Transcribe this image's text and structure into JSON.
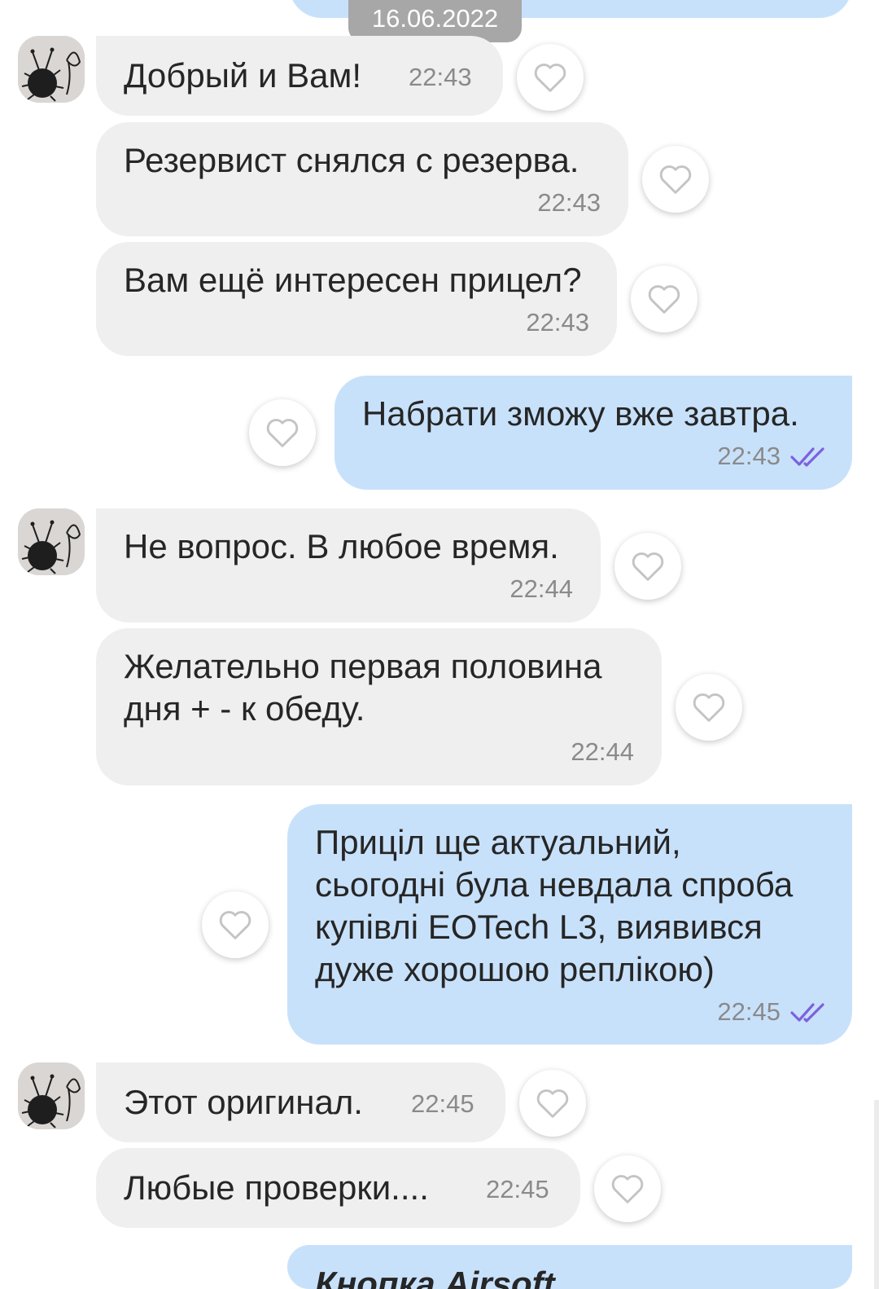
{
  "date_separator": "16.06.2022",
  "colors": {
    "incoming": "#efefef",
    "outgoing": "#c8e1fb",
    "read_ticks": "#7b61e0"
  },
  "icons": {
    "like": "heart-outline-icon",
    "read": "double-check-icon",
    "avatar": "fuzzy-bug-avatar"
  },
  "messages": [
    {
      "text": "Добрый и Вам!",
      "time": "22:43"
    },
    {
      "text": "Резервист снялся с резерва.",
      "time": "22:43"
    },
    {
      "text": "Вам ещё интересен прицел?",
      "time": "22:43"
    },
    {
      "text": "Набрати зможу вже завтра.",
      "time": "22:43"
    },
    {
      "text": "Не вопрос. В любое время.",
      "time": "22:44"
    },
    {
      "lines": [
        "Желательно первая половина",
        "дня + - к обеду."
      ],
      "time": "22:44"
    },
    {
      "lines": [
        "Приціл ще актуальний,",
        "сьогодні була невдала спроба",
        "купівлі EOTech L3, виявився",
        "дуже хорошою реплікою)"
      ],
      "time": "22:45"
    },
    {
      "text": "Этот оригинал.",
      "time": "22:45"
    },
    {
      "text": "Любые проверки....",
      "time": "22:45"
    },
    {
      "text": "Кнопка Airsoft",
      "time": ""
    }
  ]
}
